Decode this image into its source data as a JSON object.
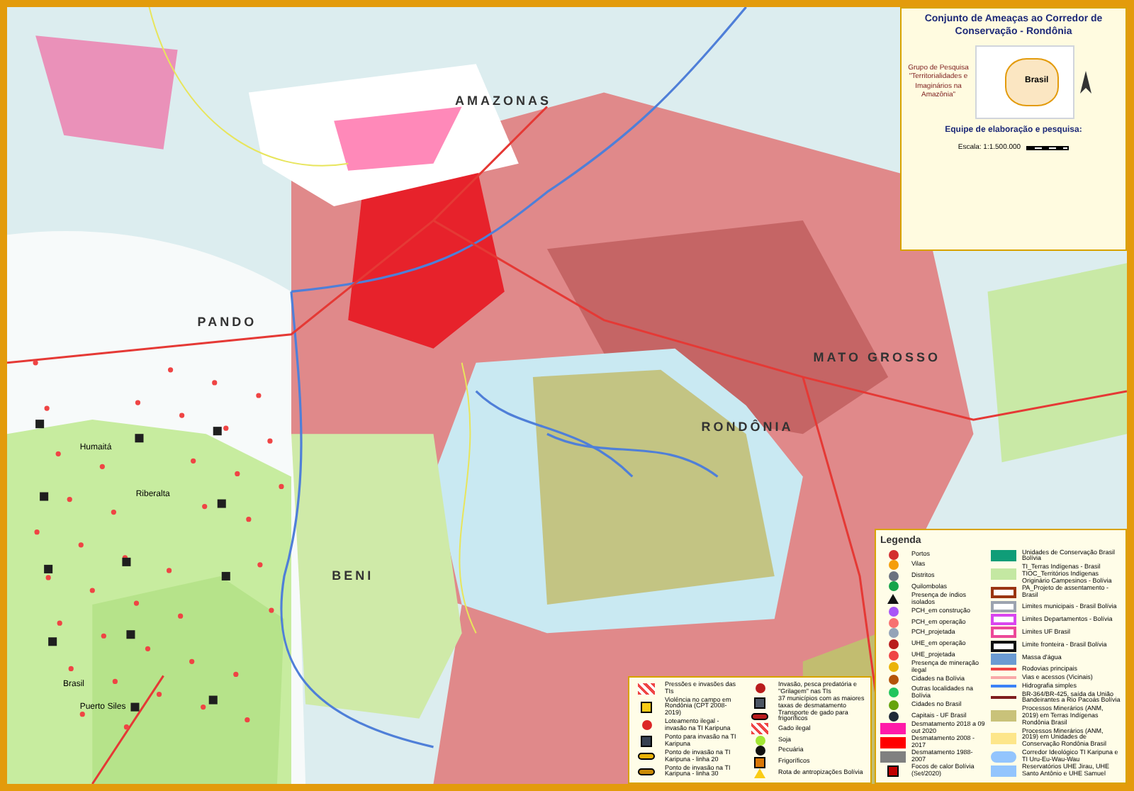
{
  "map": {
    "labels": [
      {
        "kind": "region",
        "text": "AMAZONAS"
      },
      {
        "kind": "region",
        "text": "PANDO"
      },
      {
        "kind": "region",
        "text": "BENI"
      },
      {
        "kind": "region",
        "text": "RONDÔNIA"
      },
      {
        "kind": "region",
        "text": "MATO GROSSO"
      },
      {
        "kind": "place",
        "text": "Humaitá"
      },
      {
        "kind": "place",
        "text": "Riberalta"
      },
      {
        "kind": "place",
        "text": "Brasil"
      },
      {
        "kind": "place",
        "text": "Puerto Siles"
      }
    ]
  },
  "title_box": {
    "title": "Conjunto de Ameaças ao Corredor de Conservação - Rondônia",
    "group": "Grupo de Pesquisa \"Territorialidades e Imaginários na Amazônia\"",
    "map_label": "Brasil",
    "credits": "Equipe de elaboração e pesquisa:",
    "scale": "Escala: 1:1.500.000"
  },
  "legend": {
    "title": "Legenda",
    "left": [
      {
        "kind": "dot",
        "color": "#d32f2f",
        "label": "Portos"
      },
      {
        "kind": "dot",
        "color": "#f59e0b",
        "label": "Vilas"
      },
      {
        "kind": "dot",
        "color": "#6b7280",
        "label": "Distritos"
      },
      {
        "kind": "dot",
        "color": "#16a34a",
        "label": "Quilombolas"
      },
      {
        "kind": "tri",
        "color": "#111111",
        "label": "Presença de índios isolados"
      },
      {
        "kind": "dot",
        "color": "#a855f7",
        "label": "PCH_em construção"
      },
      {
        "kind": "dot",
        "color": "#f87171",
        "label": "PCH_em operação"
      },
      {
        "kind": "dot",
        "color": "#94a3b8",
        "label": "PCH_projetada"
      },
      {
        "kind": "dot",
        "color": "#b91c1c",
        "label": "UHE_em operação"
      },
      {
        "kind": "dot",
        "color": "#ef4444",
        "label": "UHE_projetada"
      },
      {
        "kind": "dot",
        "color": "#eab308",
        "label": "Presença de mineração ilegal"
      },
      {
        "kind": "dot",
        "color": "#b45309",
        "label": "Cidades na Bolívia"
      },
      {
        "kind": "dot",
        "color": "#22c55e",
        "label": "Outras localidades na Bolívia"
      },
      {
        "kind": "dot",
        "color": "#65a30d",
        "label": "Cidades no Brasil"
      },
      {
        "kind": "dot",
        "color": "#1f2937",
        "label": "Capitais - UF Brasil"
      },
      {
        "kind": "fill",
        "color": "#ff1aa8",
        "label": "Desmatamento 2018 a 09 out 2020"
      },
      {
        "kind": "fill",
        "color": "#ff0000",
        "label": "Desmatamento 2008 - 2017"
      },
      {
        "kind": "fill",
        "color": "#808080",
        "label": "Desmatamento 1988-2007"
      },
      {
        "kind": "square",
        "color": "#c00000",
        "label": "Focos de calor Bolívia (Set/2020)"
      }
    ],
    "right": [
      {
        "kind": "fill",
        "color": "#0f9d78",
        "label": "Unidades de Conservação Brasil Bolívia"
      },
      {
        "kind": "fill",
        "color": "#c4e8a2",
        "label": "TI_Terras Indígenas - Brasil TIOC_Territórios Indígenas Originário Campesinos - Bolívia"
      },
      {
        "kind": "outline",
        "color": "#9a3412",
        "label": "PA_Projeto de assentamento - Brasil"
      },
      {
        "kind": "outline",
        "color": "#9ca3af",
        "label": "Limites municipais - Brasil Bolívia"
      },
      {
        "kind": "outline",
        "color": "#d946ef",
        "label": "Limites Departamentos - Bolívia"
      },
      {
        "kind": "outline",
        "color": "#ec4899",
        "label": "Limites UF Brasil"
      },
      {
        "kind": "outline",
        "color": "#111111",
        "label": "Limite fronteira - Brasil Bolívia"
      },
      {
        "kind": "fill",
        "color": "#6b9bd2",
        "label": "Massa d'água"
      },
      {
        "kind": "line",
        "color": "#ef4444",
        "label": "Rodovias principais"
      },
      {
        "kind": "line",
        "color": "#f9a8a8",
        "label": "Vias e acessos (Vicinais)"
      },
      {
        "kind": "line",
        "color": "#3b82f6",
        "label": "Hidrografia simples"
      },
      {
        "kind": "line",
        "color": "#7f1d1d",
        "label": "BR-364/BR-425, saída da União Bandeirantes a Rio Pacoás Bolívia"
      },
      {
        "kind": "fill",
        "color": "#c9c27a",
        "label": "Processos Minerários (ANM, 2019) em Terras Indígenas Rondônia Brasil"
      },
      {
        "kind": "fill",
        "color": "#fde68a",
        "label": "Processos Minerários (ANM, 2019) em Unidades de Conservação Rondônia Brasil"
      },
      {
        "kind": "ellipse",
        "color": "#93c5fd",
        "label": "Corredor Ideológico TI Karipuna e TI Uru-Eu-Wau-Wau"
      },
      {
        "kind": "fill",
        "color": "#93c5fd",
        "label": "Reservatórios UHE Jirau, UHE Santo Antônio e UHE Samuel"
      }
    ]
  },
  "threats": {
    "left": [
      {
        "kind": "hatch",
        "color": "#ef4444",
        "label": "Pressões e invasões das TIs"
      },
      {
        "kind": "square",
        "color": "#facc15",
        "label": "Violência no campo em Rondônia (CPT 2008-2019)"
      },
      {
        "kind": "dot",
        "color": "#dc2626",
        "label": "Loteamento ilegal - invasão na TI Karipuna"
      },
      {
        "kind": "square",
        "color": "#374151",
        "label": "Ponto para invasão na TI Karipuna"
      },
      {
        "kind": "pill",
        "color": "#eab308",
        "label": "Ponto de invasão na TI Karipuna - linha 20"
      },
      {
        "kind": "pill",
        "color": "#ca8a04",
        "label": "Ponto de invasão na TI Karipuna - linha 30"
      }
    ],
    "right": [
      {
        "kind": "dot",
        "color": "#b91c1c",
        "label": "Invasão, pesca predatória e \"Grilagem\" nas TIs"
      },
      {
        "kind": "square",
        "color": "#4b5563",
        "label": "37 municípios com as maiores taxas de desmatamento"
      },
      {
        "kind": "pill",
        "color": "#b91c1c",
        "label": "Transporte de gado para frigoríficos"
      },
      {
        "kind": "hatch",
        "color": "#ef4444",
        "label": "Gado ilegal"
      },
      {
        "kind": "dot",
        "color": "#a3e635",
        "label": "Soja"
      },
      {
        "kind": "dot",
        "color": "#111111",
        "label": "Pecuária"
      },
      {
        "kind": "square",
        "color": "#d97706",
        "label": "Frigoríficos"
      },
      {
        "kind": "tri",
        "color": "#facc15",
        "label": "Rota de antropizações Bolívia"
      }
    ]
  }
}
